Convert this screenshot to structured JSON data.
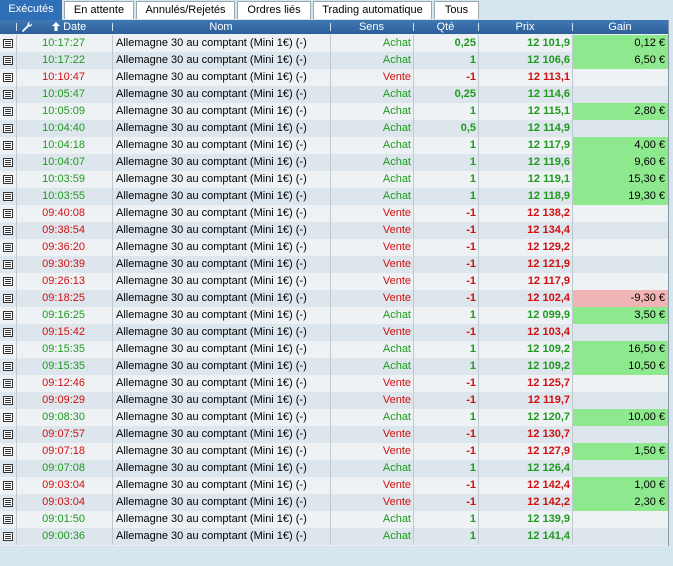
{
  "tabs": [
    {
      "label": "Exécutés",
      "active": true
    },
    {
      "label": "En attente",
      "active": false
    },
    {
      "label": "Annulés/Rejetés",
      "active": false
    },
    {
      "label": "Ordres liés",
      "active": false
    },
    {
      "label": "Trading automatique",
      "active": false
    },
    {
      "label": "Tous",
      "active": false
    }
  ],
  "columns": {
    "date": "Date",
    "nom": "Nom",
    "sens": "Sens",
    "qte": "Qté",
    "prix": "Prix",
    "gain": "Gain"
  },
  "icons": {
    "settings": "wrench-icon",
    "sort": "sort-up-arrow-icon",
    "row": "document-icon"
  },
  "colors": {
    "achat": "#1f9a1f",
    "vente": "#d01010",
    "gain_pos": "#8ee88e",
    "gain_neg": "#f1b4b4",
    "header": "#2f6fb8"
  },
  "rows": [
    {
      "date": "10:17:27",
      "nom": "Allemagne 30 au comptant (Mini 1€) (-)",
      "sens": "Achat",
      "qte": "0,25",
      "prix": "12 101,9",
      "gain": "0,12 €"
    },
    {
      "date": "10:17:22",
      "nom": "Allemagne 30 au comptant (Mini 1€) (-)",
      "sens": "Achat",
      "qte": "1",
      "prix": "12 106,6",
      "gain": "6,50 €"
    },
    {
      "date": "10:10:47",
      "nom": "Allemagne 30 au comptant (Mini 1€) (-)",
      "sens": "Vente",
      "qte": "-1",
      "prix": "12 113,1",
      "gain": ""
    },
    {
      "date": "10:05:47",
      "nom": "Allemagne 30 au comptant (Mini 1€) (-)",
      "sens": "Achat",
      "qte": "0,25",
      "prix": "12 114,6",
      "gain": ""
    },
    {
      "date": "10:05:09",
      "nom": "Allemagne 30 au comptant (Mini 1€) (-)",
      "sens": "Achat",
      "qte": "1",
      "prix": "12 115,1",
      "gain": "2,80 €"
    },
    {
      "date": "10:04:40",
      "nom": "Allemagne 30 au comptant (Mini 1€) (-)",
      "sens": "Achat",
      "qte": "0,5",
      "prix": "12 114,9",
      "gain": ""
    },
    {
      "date": "10:04:18",
      "nom": "Allemagne 30 au comptant (Mini 1€) (-)",
      "sens": "Achat",
      "qte": "1",
      "prix": "12 117,9",
      "gain": "4,00 €"
    },
    {
      "date": "10:04:07",
      "nom": "Allemagne 30 au comptant (Mini 1€) (-)",
      "sens": "Achat",
      "qte": "1",
      "prix": "12 119,6",
      "gain": "9,60 €"
    },
    {
      "date": "10:03:59",
      "nom": "Allemagne 30 au comptant (Mini 1€) (-)",
      "sens": "Achat",
      "qte": "1",
      "prix": "12 119,1",
      "gain": "15,30 €"
    },
    {
      "date": "10:03:55",
      "nom": "Allemagne 30 au comptant (Mini 1€) (-)",
      "sens": "Achat",
      "qte": "1",
      "prix": "12 118,9",
      "gain": "19,30 €"
    },
    {
      "date": "09:40:08",
      "nom": "Allemagne 30 au comptant (Mini 1€) (-)",
      "sens": "Vente",
      "qte": "-1",
      "prix": "12 138,2",
      "gain": ""
    },
    {
      "date": "09:38:54",
      "nom": "Allemagne 30 au comptant (Mini 1€) (-)",
      "sens": "Vente",
      "qte": "-1",
      "prix": "12 134,4",
      "gain": ""
    },
    {
      "date": "09:36:20",
      "nom": "Allemagne 30 au comptant (Mini 1€) (-)",
      "sens": "Vente",
      "qte": "-1",
      "prix": "12 129,2",
      "gain": ""
    },
    {
      "date": "09:30:39",
      "nom": "Allemagne 30 au comptant (Mini 1€) (-)",
      "sens": "Vente",
      "qte": "-1",
      "prix": "12 121,9",
      "gain": ""
    },
    {
      "date": "09:26:13",
      "nom": "Allemagne 30 au comptant (Mini 1€) (-)",
      "sens": "Vente",
      "qte": "-1",
      "prix": "12 117,9",
      "gain": ""
    },
    {
      "date": "09:18:25",
      "nom": "Allemagne 30 au comptant (Mini 1€) (-)",
      "sens": "Vente",
      "qte": "-1",
      "prix": "12 102,4",
      "gain": "-9,30 €"
    },
    {
      "date": "09:16:25",
      "nom": "Allemagne 30 au comptant (Mini 1€) (-)",
      "sens": "Achat",
      "qte": "1",
      "prix": "12 099,9",
      "gain": "3,50 €"
    },
    {
      "date": "09:15:42",
      "nom": "Allemagne 30 au comptant (Mini 1€) (-)",
      "sens": "Vente",
      "qte": "-1",
      "prix": "12 103,4",
      "gain": ""
    },
    {
      "date": "09:15:35",
      "nom": "Allemagne 30 au comptant (Mini 1€) (-)",
      "sens": "Achat",
      "qte": "1",
      "prix": "12 109,2",
      "gain": "16,50 €"
    },
    {
      "date": "09:15:35",
      "nom": "Allemagne 30 au comptant (Mini 1€) (-)",
      "sens": "Achat",
      "qte": "1",
      "prix": "12 109,2",
      "gain": "10,50 €"
    },
    {
      "date": "09:12:46",
      "nom": "Allemagne 30 au comptant (Mini 1€) (-)",
      "sens": "Vente",
      "qte": "-1",
      "prix": "12 125,7",
      "gain": ""
    },
    {
      "date": "09:09:29",
      "nom": "Allemagne 30 au comptant (Mini 1€) (-)",
      "sens": "Vente",
      "qte": "-1",
      "prix": "12 119,7",
      "gain": ""
    },
    {
      "date": "09:08:30",
      "nom": "Allemagne 30 au comptant (Mini 1€) (-)",
      "sens": "Achat",
      "qte": "1",
      "prix": "12 120,7",
      "gain": "10,00 €"
    },
    {
      "date": "09:07:57",
      "nom": "Allemagne 30 au comptant (Mini 1€) (-)",
      "sens": "Vente",
      "qte": "-1",
      "prix": "12 130,7",
      "gain": ""
    },
    {
      "date": "09:07:18",
      "nom": "Allemagne 30 au comptant (Mini 1€) (-)",
      "sens": "Vente",
      "qte": "-1",
      "prix": "12 127,9",
      "gain": "1,50 €"
    },
    {
      "date": "09:07:08",
      "nom": "Allemagne 30 au comptant (Mini 1€) (-)",
      "sens": "Achat",
      "qte": "1",
      "prix": "12 126,4",
      "gain": ""
    },
    {
      "date": "09:03:04",
      "nom": "Allemagne 30 au comptant (Mini 1€) (-)",
      "sens": "Vente",
      "qte": "-1",
      "prix": "12 142,4",
      "gain": "1,00 €"
    },
    {
      "date": "09:03:04",
      "nom": "Allemagne 30 au comptant (Mini 1€) (-)",
      "sens": "Vente",
      "qte": "-1",
      "prix": "12 142,2",
      "gain": "2,30 €"
    },
    {
      "date": "09:01:50",
      "nom": "Allemagne 30 au comptant (Mini 1€) (-)",
      "sens": "Achat",
      "qte": "1",
      "prix": "12 139,9",
      "gain": ""
    },
    {
      "date": "09:00:36",
      "nom": "Allemagne 30 au comptant (Mini 1€) (-)",
      "sens": "Achat",
      "qte": "1",
      "prix": "12 141,4",
      "gain": ""
    }
  ]
}
